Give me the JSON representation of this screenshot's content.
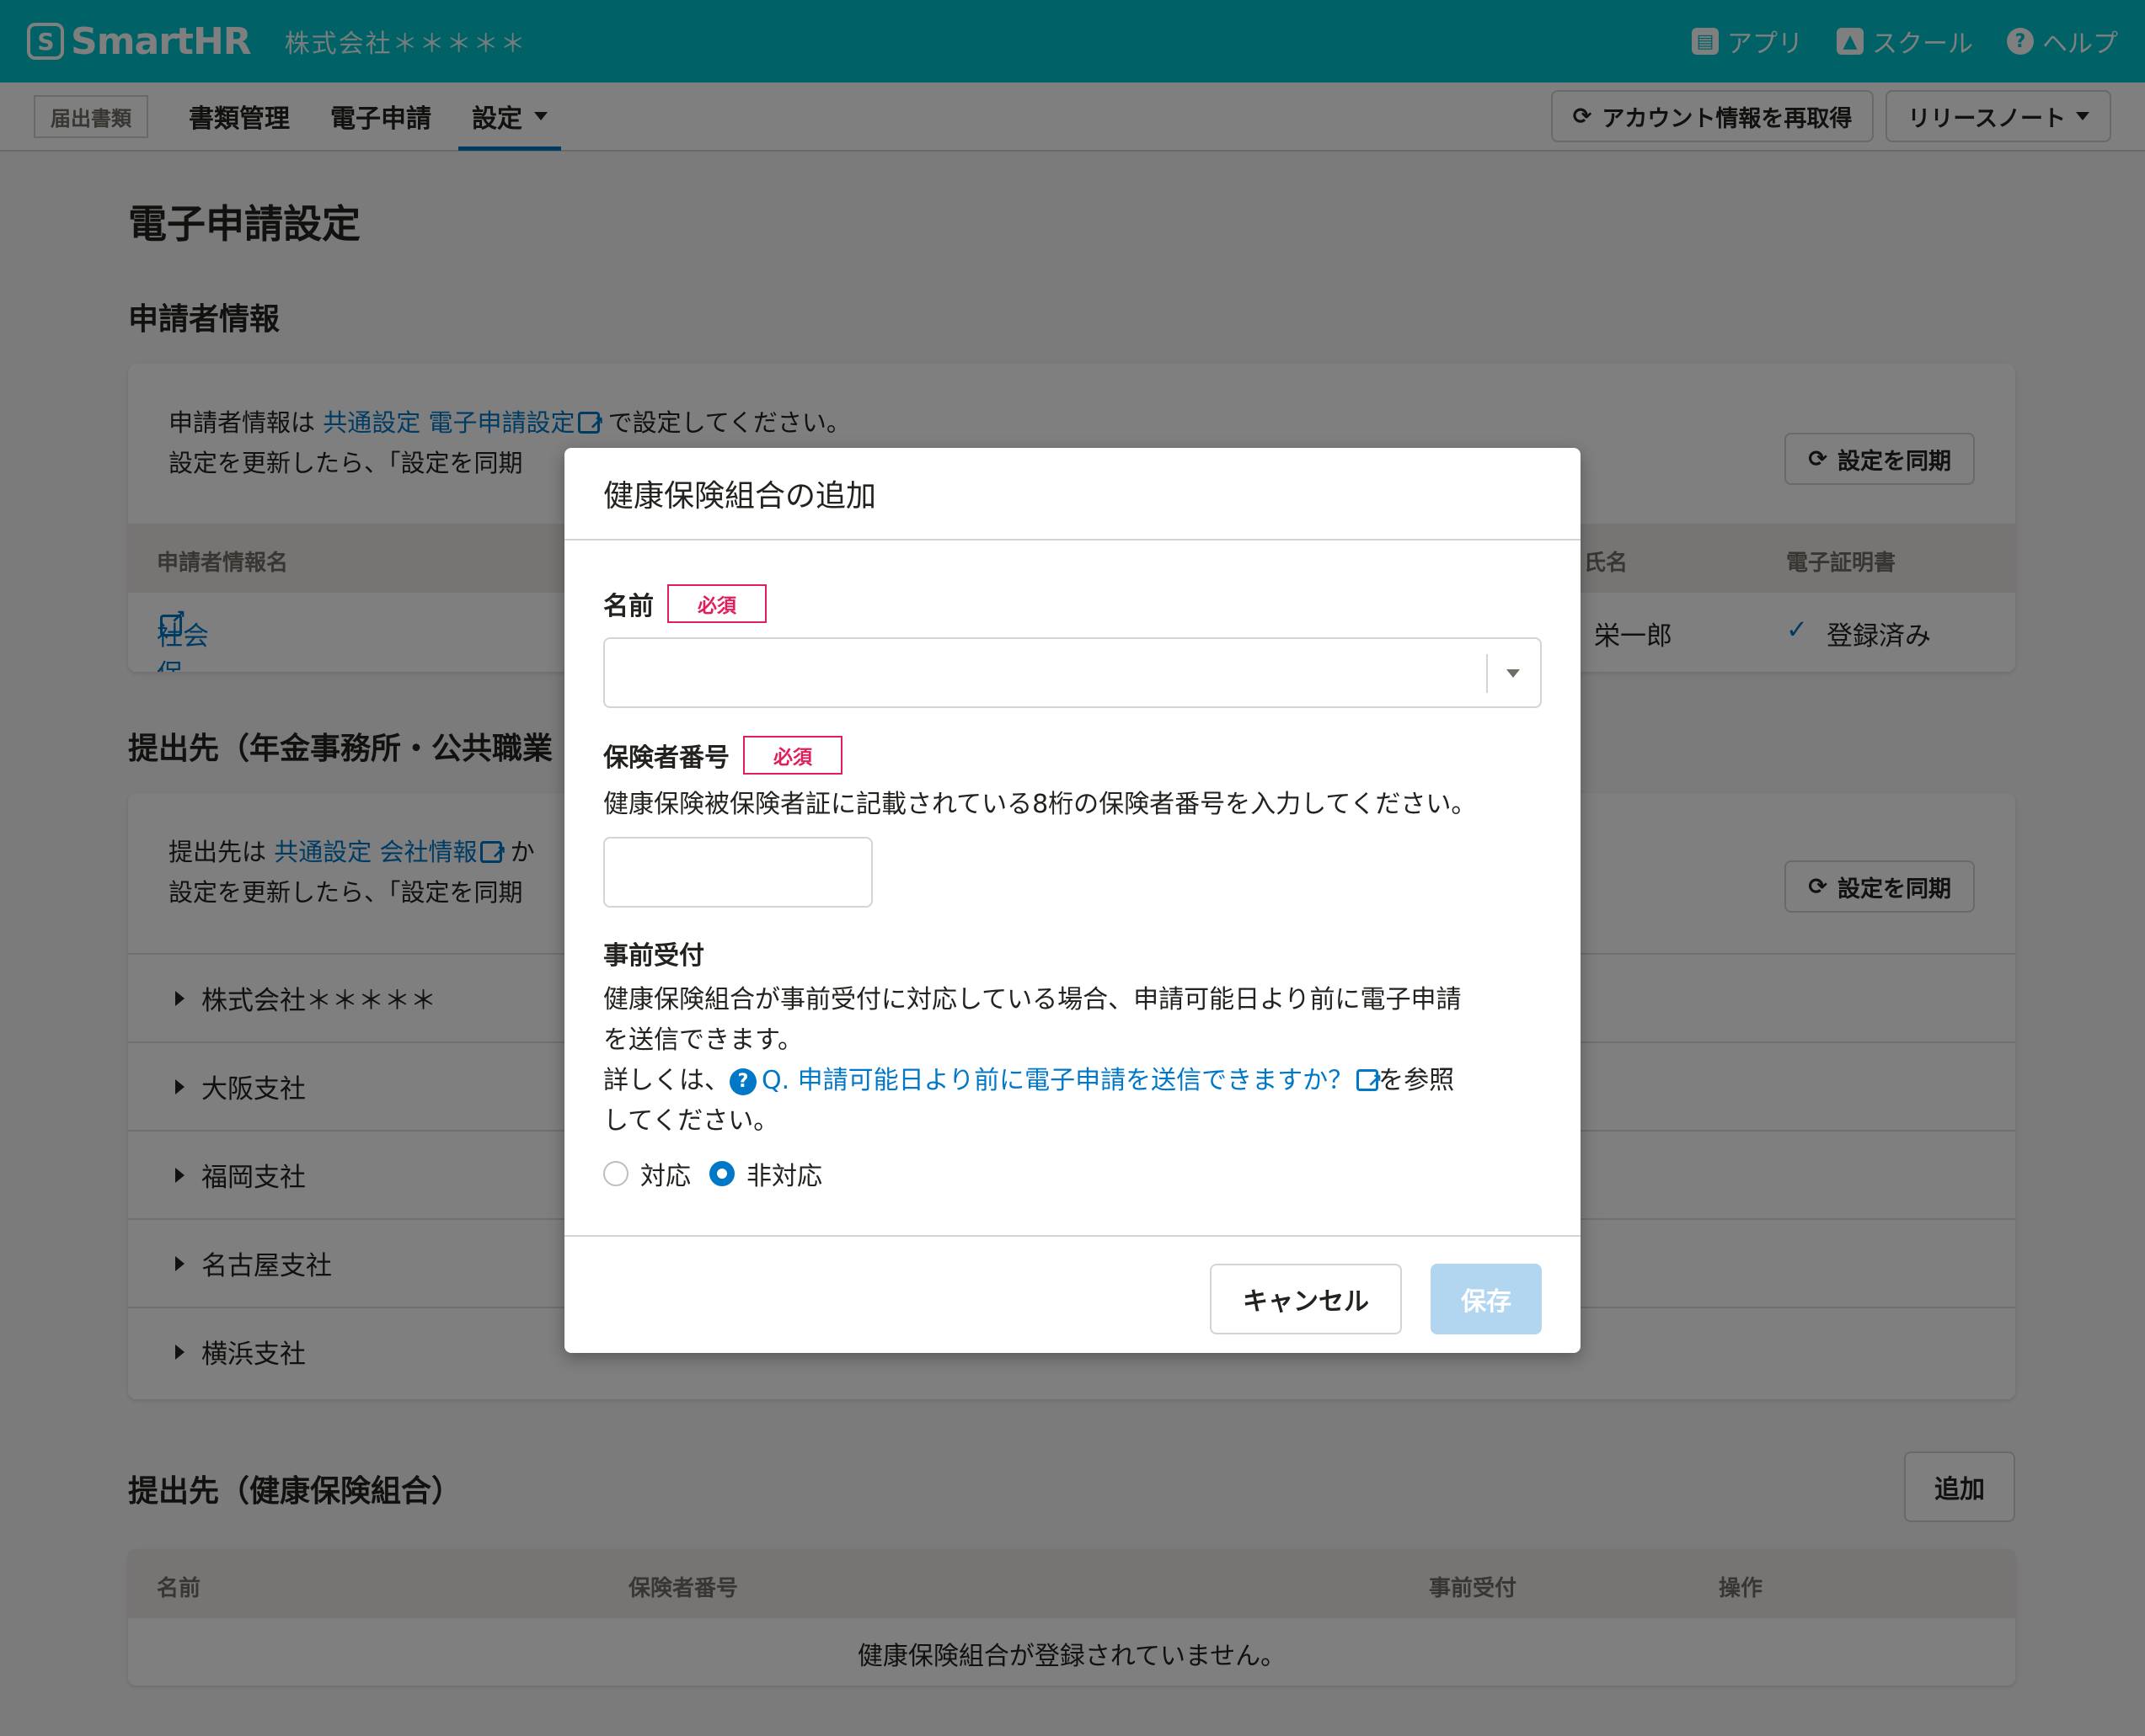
{
  "header": {
    "logo_mark": "S",
    "logo_text": "SmartHR",
    "tenant": "株式会社＊＊＊＊＊",
    "links": [
      {
        "icon": "toolbox-icon",
        "glyph": "▤",
        "label": "アプリ"
      },
      {
        "icon": "graduation-cap-icon",
        "glyph": "▲",
        "label": "スクール"
      },
      {
        "icon": "question-circle-icon",
        "glyph": "?",
        "label": "ヘルプ"
      }
    ]
  },
  "nav": {
    "badge": "届出書類",
    "items": [
      "書類管理",
      "電子申請",
      "設定"
    ],
    "active": "設定",
    "refresh_button": "アカウント情報を再取得",
    "release_notes": "リリースノート"
  },
  "page": {
    "title": "電子申請設定",
    "applicant": {
      "heading": "申請者情報",
      "note_prefix": "申請者情報は",
      "note_link": "共通設定 電子申請設定",
      "note_suffix": "で設定してください。",
      "note_line2": "設定を更新したら、「設定を同期",
      "sync_button": "設定を同期",
      "columns": [
        "申請者情報名",
        "氏名",
        "電子証明書"
      ],
      "row": {
        "name": "社会保険・労働保険共通",
        "person": "栄一郎",
        "certificate": "登録済み"
      }
    },
    "submission": {
      "heading": "提出先（年金事務所・公共職業",
      "note_prefix": "提出先は",
      "note_link": "共通設定 会社情報",
      "note_suffix": "か",
      "note_line2": "設定を更新したら、「設定を同期",
      "sync_button": "設定を同期",
      "offices": [
        "株式会社＊＊＊＊＊",
        "大阪支社",
        "福岡支社",
        "名古屋支社",
        "横浜支社"
      ]
    },
    "union": {
      "heading": "提出先（健康保険組合）",
      "add_button": "追加",
      "columns": [
        "名前",
        "保険者番号",
        "事前受付",
        "操作"
      ],
      "empty": "健康保険組合が登録されていません。"
    }
  },
  "modal": {
    "title": "健康保険組合の追加",
    "name_label": "名前",
    "required": "必須",
    "insurer_label": "保険者番号",
    "insurer_help": "健康保険被保険者証に記載されている8桁の保険者番号を入力してください。",
    "advance_label": "事前受付",
    "advance_text_1": "健康保険組合が事前受付に対応している場合、申請可能日より前に電子申請",
    "advance_text_2": "を送信できます。",
    "advance_more_prefix": "詳しくは、",
    "advance_link": "Q. 申請可能日より前に電子申請を送信できますか？",
    "advance_more_suffix": "を参照",
    "advance_more_line2": "してください。",
    "options": [
      "対応",
      "非対応"
    ],
    "selected": "非対応",
    "cancel": "キャンセル",
    "save": "保存"
  },
  "colors": {
    "brand": "#00c4cc",
    "link": "#0077c7",
    "required": "#e01e5a",
    "save_disabled": "#b2d6ef"
  }
}
